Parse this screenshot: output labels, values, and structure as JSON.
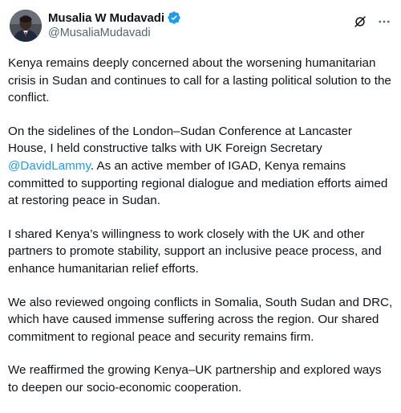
{
  "author": {
    "display_name": "Musalia W Mudavadi",
    "handle": "@MusaliaMudavadi",
    "verified_color": "#1d9bf0"
  },
  "icons": {
    "verified": "verified-badge-icon",
    "grok": "grok-icon",
    "more": "more-options-icon"
  },
  "tweet": {
    "p1": "Kenya remains deeply concerned about the worsening humanitarian crisis in Sudan and continues to call for a lasting political solution to the conflict.",
    "p2_before": "On the sidelines of the London–Sudan Conference at Lancaster House, I held constructive talks with UK Foreign Secretary ",
    "p2_mention": "@DavidLammy",
    "p2_after": ". As an active member of IGAD, Kenya remains committed to supporting regional dialogue and mediation efforts aimed at restoring peace in Sudan.",
    "p3": "I shared Kenya’s willingness to work closely with the UK and other partners to promote stability, support an inclusive peace process, and enhance humanitarian relief efforts.",
    "p4": "We also reviewed ongoing conflicts in Somalia, South Sudan and DRC, which have caused immense suffering across the region. Our shared commitment to regional peace and security remains firm.",
    "p5": "We reaffirmed the growing Kenya–UK partnership and explored ways to deepen our socio-economic cooperation."
  },
  "colors": {
    "text": "#0f1419",
    "secondary": "#536471",
    "link": "#1d9bf0"
  }
}
